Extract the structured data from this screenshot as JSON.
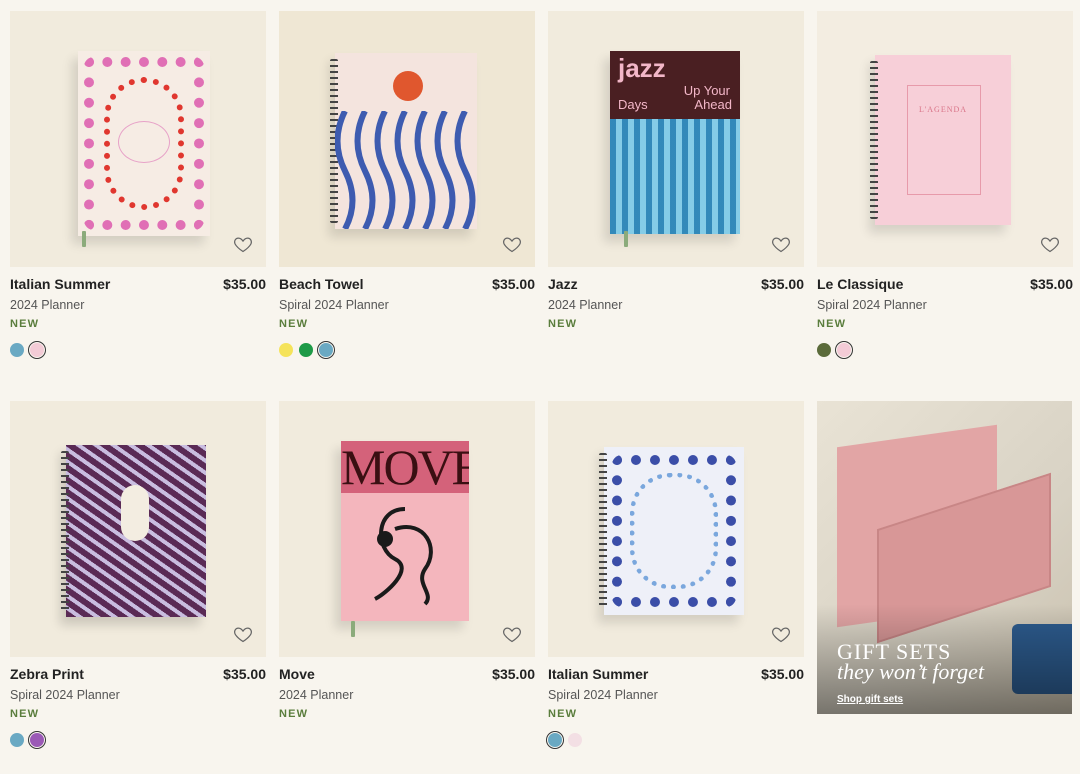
{
  "products": [
    {
      "name": "Italian Summer",
      "price": "$35.00",
      "subtitle": "2024 Planner",
      "badge": "NEW",
      "swatches": [
        "#6aa9c3",
        "#f3cbd6"
      ],
      "selected": 1,
      "icon": "heart-icon"
    },
    {
      "name": "Beach Towel",
      "price": "$35.00",
      "subtitle": "Spiral 2024 Planner",
      "badge": "NEW",
      "swatches": [
        "#f5e35a",
        "#1e9a47",
        "#6aa9c3"
      ],
      "selected": 2,
      "icon": "heart-icon"
    },
    {
      "name": "Jazz",
      "price": "$35.00",
      "subtitle": "2024 Planner",
      "badge": "NEW",
      "swatches": [],
      "selected": -1,
      "icon": "heart-icon",
      "cover_text": {
        "line1": "jazz",
        "line2": "Up Your",
        "line3": "Days",
        "line4": "Ahead"
      }
    },
    {
      "name": "Le Classique",
      "price": "$35.00",
      "subtitle": "Spiral 2024 Planner",
      "badge": "NEW",
      "swatches": [
        "#5b6b3a",
        "#f3cbd6"
      ],
      "selected": 1,
      "icon": "heart-icon",
      "cover_text": {
        "title": "L'AGENDA"
      }
    },
    {
      "name": "Zebra Print",
      "price": "$35.00",
      "subtitle": "Spiral 2024 Planner",
      "badge": "NEW",
      "swatches": [
        "#6aa9c3",
        "#9b59b6"
      ],
      "selected": 1,
      "icon": "heart-icon"
    },
    {
      "name": "Move",
      "price": "$35.00",
      "subtitle": "2024 Planner",
      "badge": "NEW",
      "swatches": [],
      "selected": -1,
      "icon": "heart-icon",
      "cover_text": {
        "title": "MOVE"
      }
    },
    {
      "name": "Italian Summer",
      "price": "$35.00",
      "subtitle": "Spiral 2024 Planner",
      "badge": "NEW",
      "swatches": [
        "#6aa9c3",
        "#f3dfe4"
      ],
      "selected": 0,
      "icon": "heart-icon"
    }
  ],
  "gift": {
    "title": "GIFT SETS",
    "subtitle": "they won’t forget",
    "link": "Shop gift sets"
  }
}
